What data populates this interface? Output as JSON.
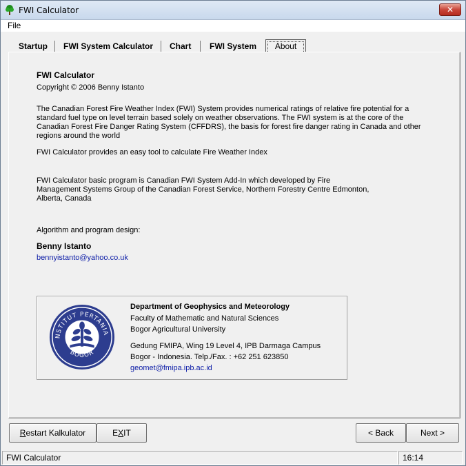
{
  "window": {
    "title": "FWI Calculator",
    "close_glyph": "✕"
  },
  "menu": {
    "file": "File"
  },
  "tabs": [
    {
      "label": "Startup"
    },
    {
      "label": "FWI System Calculator"
    },
    {
      "label": "Chart"
    },
    {
      "label": "FWI System"
    },
    {
      "label": "About",
      "active": true
    }
  ],
  "about": {
    "app_name": "FWI Calculator",
    "copyright": "Copyright © 2006 Benny Istanto",
    "paragraph1": "The Canadian Forest Fire Weather Index (FWI) System provides numerical ratings of relative fire potential for a standard fuel type on level terrain based solely on weather observations. The FWI system is at the core of the Canadian Forest Fire Danger Rating System (CFFDRS), the basis for forest fire danger rating in Canada and other regions around the world",
    "paragraph2": "FWI Calculator provides an easy tool to calculate Fire Weather Index",
    "paragraph3": "FWI Calculator basic program is Canadian FWI System Add-In which developed by Fire Management Systems Group of the Canadian Forest Service, Northern Forestry Centre Edmonton, Alberta, Canada",
    "design_label": "Algorithm and program design:",
    "author": "Benny Istanto",
    "author_email": "bennyistanto@yahoo.co.uk"
  },
  "institution": {
    "department": "Department of Geophysics and Meteorology",
    "faculty": "Faculty of Mathematic and Natural Sciences",
    "university": "Bogor Agricultural University",
    "address1": "Gedung FMIPA, Wing 19 Level 4, IPB Darmaga Campus",
    "address2": "Bogor - Indonesia. Telp./Fax. : +62 251 623850",
    "email": "geomet@fmipa.ipb.ac.id",
    "seal_text_top": "INSTITUT PERTANIAN",
    "seal_text_bottom": "BOGOR"
  },
  "buttons": {
    "restart_underline": "R",
    "restart_rest": "estart Kalkulator",
    "exit_pre": "E",
    "exit_underline": "X",
    "exit_post": "IT",
    "back": "< Back",
    "next": "Next >"
  },
  "status": {
    "left": "FWI Calculator",
    "time": "16:14"
  },
  "colors": {
    "link": "#1020a8",
    "seal": "#2d3d8f"
  }
}
